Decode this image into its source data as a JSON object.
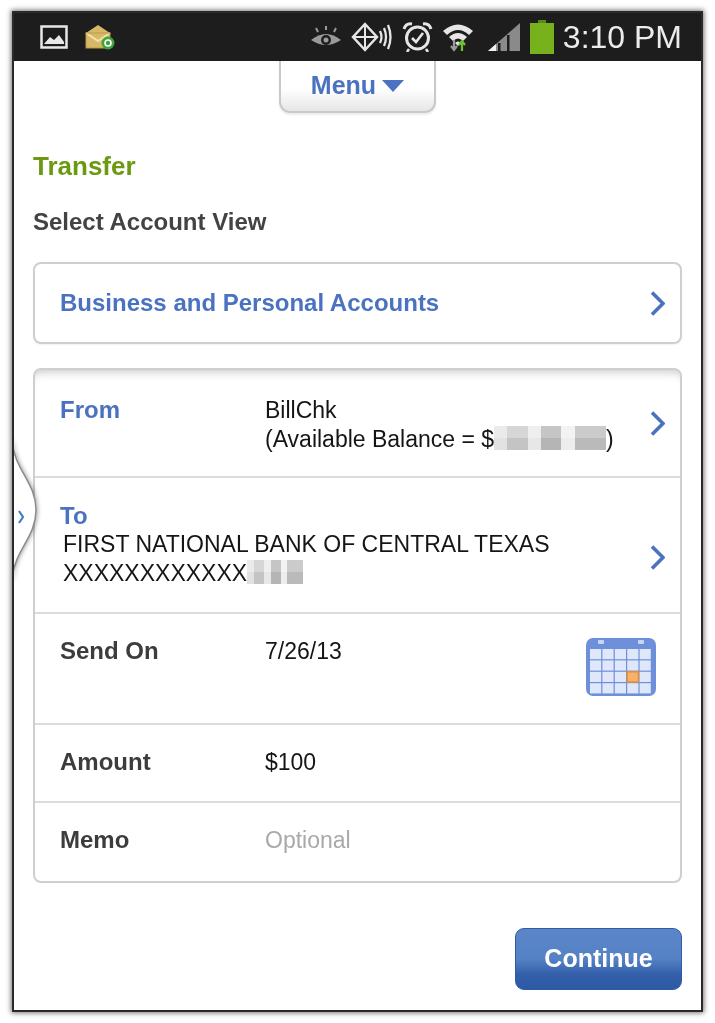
{
  "status_bar": {
    "time": "3:10 PM"
  },
  "menu_button": {
    "label": "Menu"
  },
  "page_title": "Transfer",
  "section_label": "Select Account View",
  "account_view": {
    "label": "Business and Personal Accounts"
  },
  "form_rows": [
    {
      "kind": "from",
      "label": "From",
      "account": "BillChk",
      "balance_prefix": "(Available Balance = $",
      "balance_redacted": true,
      "balance_suffix": ")"
    },
    {
      "kind": "to",
      "label": "To",
      "payee": "FIRST NATIONAL BANK OF CENTRAL TEXAS",
      "account_mask": "XXXXXXXXXXXX",
      "account_redacted": true
    },
    {
      "kind": "date",
      "label": "Send On",
      "value": "7/26/13"
    },
    {
      "kind": "amount",
      "label": "Amount",
      "value": "$100"
    },
    {
      "kind": "memo",
      "label": "Memo",
      "placeholder": "Optional"
    }
  ],
  "continue_button": {
    "label": "Continue"
  }
}
